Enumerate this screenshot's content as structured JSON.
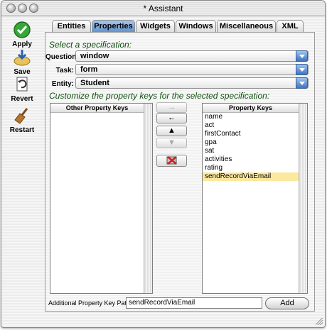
{
  "window": {
    "title": "* Assistant"
  },
  "toolbar": {
    "apply": "Apply",
    "save": "Save",
    "revert": "Revert",
    "restart": "Restart"
  },
  "tabs": [
    "Entities",
    "Properties",
    "Widgets",
    "Windows",
    "Miscellaneous",
    "XML"
  ],
  "active_tab": "Properties",
  "spec": {
    "title": "Select a specification:",
    "question_label": "Question:",
    "question_value": "window",
    "task_label": "Task:",
    "task_value": "form",
    "entity_label": "Entity:",
    "entity_value": "Student"
  },
  "keys": {
    "title": "Customize the property keys for the selected specification:",
    "other_header": "Other Property Keys",
    "property_header": "Property Keys",
    "property_keys": [
      "name",
      "act",
      "firstContact",
      "gpa",
      "sat",
      "activities",
      "rating",
      "sendRecordViaEmail"
    ],
    "selected": "sendRecordViaEmail"
  },
  "move_buttons": {
    "add": "→",
    "remove": "←",
    "up": "▲",
    "down": "▼"
  },
  "path": {
    "label": "Additional Property Key Path:",
    "value": "sendRecordViaEmail",
    "add_button": "Add"
  }
}
